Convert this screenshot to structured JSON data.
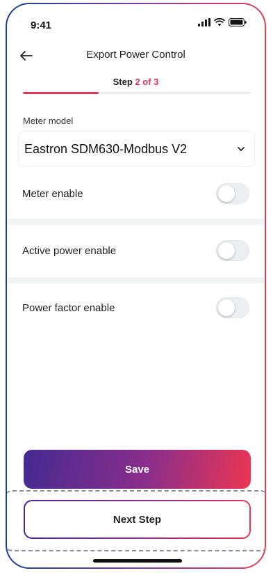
{
  "status_bar": {
    "time": "9:41"
  },
  "header": {
    "title": "Export Power Control",
    "back_icon": "arrow-left-icon"
  },
  "step": {
    "prefix": "Step ",
    "current_of_total": "2 of 3",
    "progress_fraction": 0.333
  },
  "meter": {
    "label": "Meter model",
    "selected": "Eastron SDM630-Modbus V2",
    "chevron_icon": "chevron-down-icon"
  },
  "toggles": [
    {
      "label": "Meter enable",
      "on": false
    },
    {
      "label": "Active power enable",
      "on": false
    },
    {
      "label": "Power factor enable",
      "on": false
    }
  ],
  "actions": {
    "save_label": "Save",
    "next_label": "Next Step"
  },
  "colors": {
    "accent": "#e03560",
    "gradient_start": "#452a91",
    "gradient_end": "#ea3652"
  }
}
